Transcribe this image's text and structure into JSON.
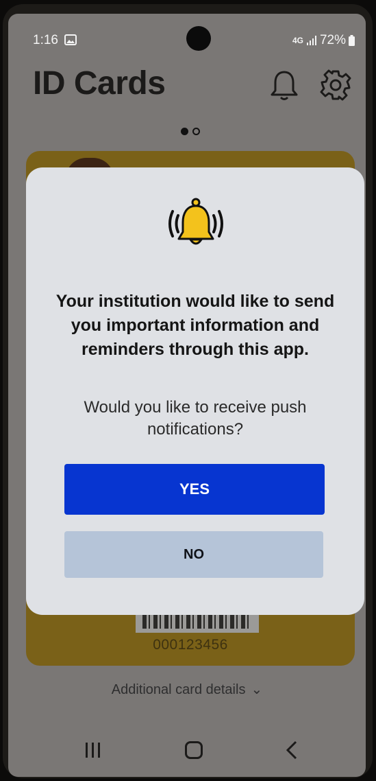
{
  "status_bar": {
    "time": "1:16",
    "network": "4G",
    "battery": "72%"
  },
  "header": {
    "title": "ID Cards"
  },
  "card": {
    "number": "000123456"
  },
  "details_link": {
    "label": "Additional card details",
    "chevron": "⌄"
  },
  "modal": {
    "heading": "Your institution would like to send you important information and reminders through this app.",
    "question": "Would you like to receive push notifications?",
    "yes_label": "YES",
    "no_label": "NO"
  },
  "icons": [
    "gallery-icon",
    "signal-icon",
    "battery-icon",
    "bell-icon",
    "gear-icon",
    "ringing-bell-icon",
    "recents-icon",
    "home-icon",
    "back-icon"
  ],
  "colors": {
    "yes_button": "#0735d0",
    "no_button": "#b5c4d8",
    "modal_bg": "#dfe1e5",
    "bell_yellow": "#f3c21c"
  }
}
